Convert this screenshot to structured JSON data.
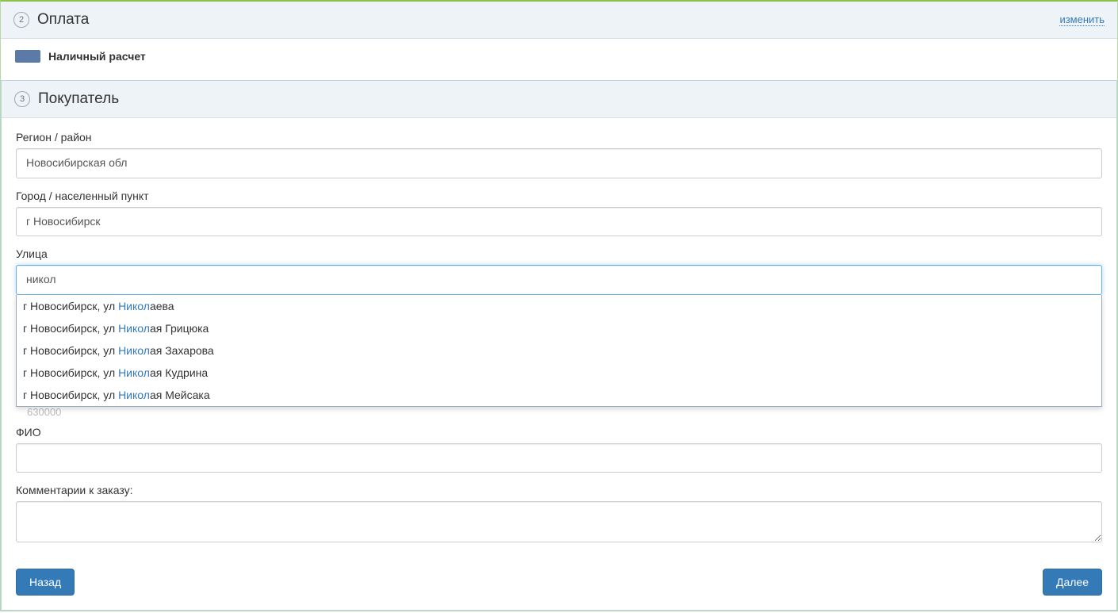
{
  "payment": {
    "step_number": "2",
    "title": "Оплата",
    "change_link": "изменить",
    "method_label": "Наличный расчет"
  },
  "buyer": {
    "step_number": "3",
    "title": "Покупатель",
    "region": {
      "label": "Регион / район",
      "value": "Новосибирская обл"
    },
    "city": {
      "label": "Город / населенный пункт",
      "value": "г Новосибирск"
    },
    "street": {
      "label": "Улица",
      "value": "никол"
    },
    "autocomplete": {
      "items": [
        {
          "prefix": "г Новосибирск, ул ",
          "match": "Никол",
          "suffix": "аева"
        },
        {
          "prefix": "г Новосибирск, ул ",
          "match": "Никол",
          "suffix": "ая Грицюка"
        },
        {
          "prefix": "г Новосибирск, ул ",
          "match": "Никол",
          "suffix": "ая Захарова"
        },
        {
          "prefix": "г Новосибирск, ул ",
          "match": "Никол",
          "suffix": "ая Кудрина"
        },
        {
          "prefix": "г Новосибирск, ул ",
          "match": "Никол",
          "suffix": "ая Мейсака"
        }
      ]
    },
    "postcode_ghost": "630000",
    "fullname": {
      "label": "ФИО",
      "value": ""
    },
    "comments": {
      "label": "Комментарии к заказу:",
      "value": ""
    }
  },
  "buttons": {
    "back": "Назад",
    "next": "Далее"
  }
}
